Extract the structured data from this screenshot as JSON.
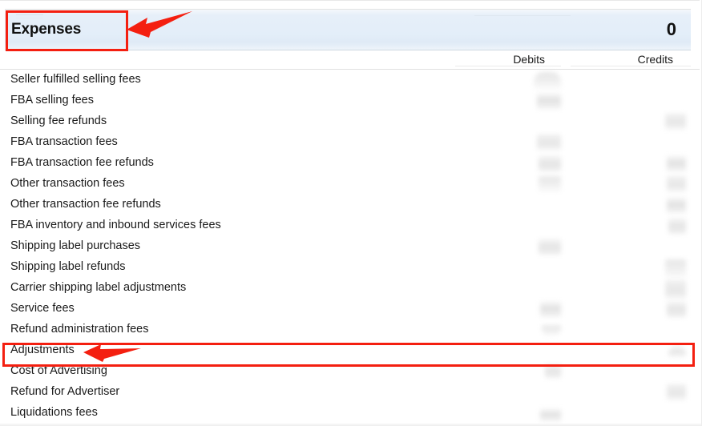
{
  "section": {
    "title": "Expenses",
    "total": "0"
  },
  "columns": {
    "debits": "Debits",
    "credits": "Credits"
  },
  "rows": [
    {
      "label": "Seller fulfilled selling fees"
    },
    {
      "label": "FBA selling fees"
    },
    {
      "label": "Selling fee refunds"
    },
    {
      "label": "FBA transaction fees"
    },
    {
      "label": "FBA transaction fee refunds"
    },
    {
      "label": "Other transaction fees"
    },
    {
      "label": "Other transaction fee refunds"
    },
    {
      "label": "FBA inventory and inbound services fees"
    },
    {
      "label": "Shipping label purchases"
    },
    {
      "label": "Shipping label refunds"
    },
    {
      "label": "Carrier shipping label adjustments"
    },
    {
      "label": "Service fees"
    },
    {
      "label": "Refund administration fees"
    },
    {
      "label": "Adjustments"
    },
    {
      "label": "Cost of Advertising"
    },
    {
      "label": "Refund for Advertiser"
    },
    {
      "label": "Liquidations fees"
    }
  ],
  "annotations": {
    "color": "#f41f10",
    "highlight_title": "Expenses",
    "highlight_row": "Adjustments",
    "arrow_title_name": "arrow-pointing-to-expenses-title",
    "arrow_row_name": "arrow-pointing-to-adjustments-row"
  }
}
